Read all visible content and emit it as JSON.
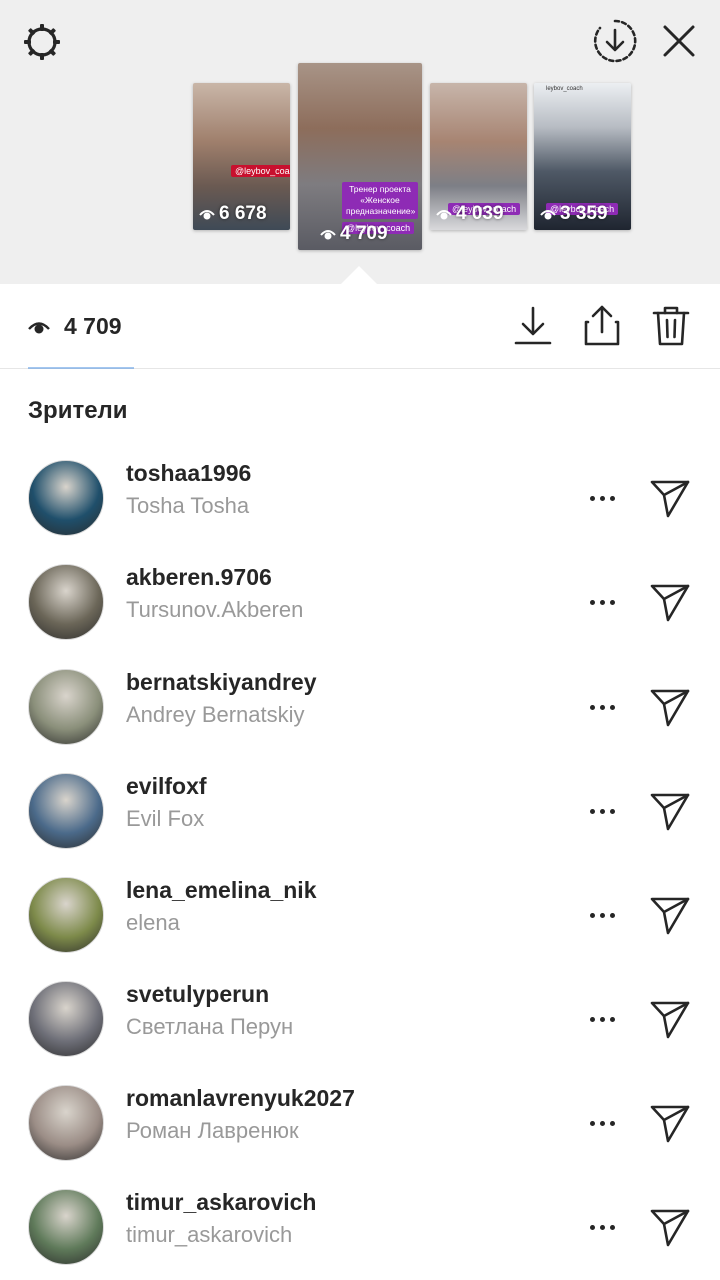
{
  "header": {
    "settings_icon": "settings-icon",
    "download_icon": "download-circle-icon",
    "close_icon": "close-icon"
  },
  "stories": [
    {
      "count": "6 678",
      "tag": "@leybov_coach"
    },
    {
      "count": "4 709",
      "caption": "Тренер проекта «Женское предназначение»",
      "tag": "@leybov_coach"
    },
    {
      "count": "4 039",
      "tag": "@leybov_coach"
    },
    {
      "count": "3 359",
      "tag": "@leybov_coach",
      "header_name": "leybov_coach"
    }
  ],
  "stats": {
    "view_count": "4 709"
  },
  "viewers": {
    "heading": "Зрители",
    "items": [
      {
        "username": "toshaa1996",
        "fullname": "Tosha Tosha",
        "avatar_color": "#1f4f6b"
      },
      {
        "username": "akberen.9706",
        "fullname": "Tursunov.Akberen",
        "avatar_color": "#6b6658"
      },
      {
        "username": "bernatskiyandrey",
        "fullname": "Andrey Bernatskiy",
        "avatar_color": "#8a8f7a"
      },
      {
        "username": "evilfoxf",
        "fullname": "Evil Fox",
        "avatar_color": "#4b6a8a"
      },
      {
        "username": "lena_emelina_nik",
        "fullname": "elena",
        "avatar_color": "#7d8a4a"
      },
      {
        "username": "svetulyperun",
        "fullname": "Светлана Перун",
        "avatar_color": "#6e6f78"
      },
      {
        "username": "romanlavrenyuk2027",
        "fullname": "Роман Лавренюк",
        "avatar_color": "#9b8d86"
      },
      {
        "username": "timur_askarovich",
        "fullname": "timur_askarovich",
        "avatar_color": "#5f7a5a"
      }
    ]
  }
}
